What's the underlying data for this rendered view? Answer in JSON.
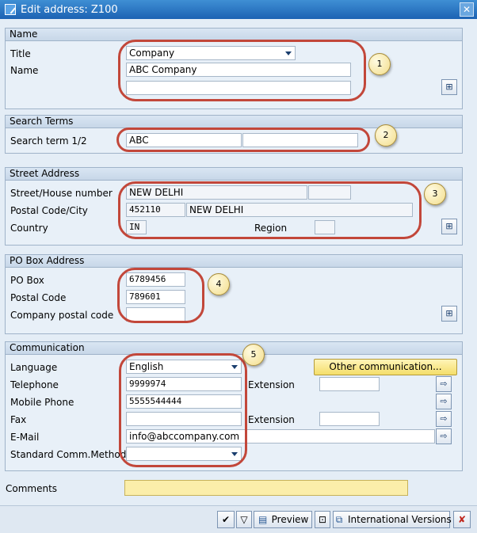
{
  "window": {
    "title": "Edit address:  Z100",
    "close_glyph": "✕"
  },
  "name_group": {
    "header": "Name",
    "title_label": "Title",
    "title_value": "Company",
    "name_label": "Name",
    "name_value": "ABC Company",
    "name2_value": ""
  },
  "search_group": {
    "header": "Search Terms",
    "label": "Search term 1/2",
    "term1": "ABC",
    "term2": ""
  },
  "street_group": {
    "header": "Street Address",
    "street_label": "Street/House number",
    "street_value": "NEW DELHI",
    "house_value": "",
    "postal_label": "Postal Code/City",
    "postal_value": "452110",
    "city_value": "NEW DELHI",
    "country_label": "Country",
    "country_value": "IN",
    "region_label": "Region",
    "region_value": ""
  },
  "pobox_group": {
    "header": "PO Box Address",
    "pobox_label": "PO Box",
    "pobox_value": "6789456",
    "postal_label": "Postal Code",
    "postal_value": "789601",
    "company_postal_label": "Company postal code",
    "company_postal_value": ""
  },
  "comm_group": {
    "header": "Communication",
    "language_label": "Language",
    "language_value": "English",
    "other_comm_label": "Other communication...",
    "telephone_label": "Telephone",
    "telephone_value": "9999974",
    "extension_label": "Extension",
    "extension_value": "",
    "mobile_label": "Mobile Phone",
    "mobile_value": "5555544444",
    "fax_label": "Fax",
    "fax_value": "",
    "fax_extension_label": "Extension",
    "fax_extension_value": "",
    "email_label": "E-Mail",
    "email_value": "info@abccompany.com",
    "std_method_label": "Standard Comm.Method",
    "std_method_value": ""
  },
  "comments": {
    "label": "Comments",
    "value": ""
  },
  "callouts": [
    "1",
    "2",
    "3",
    "4",
    "5"
  ],
  "toolbar": {
    "preview_label": "Preview",
    "intl_versions_label": "International Versions"
  },
  "icons": {
    "more-fields": "⊞",
    "arrow-right": "⇨",
    "check": "✔",
    "close": "✘"
  },
  "colors": {
    "titlebar": "#1c62b3",
    "callout_border": "#c2473a",
    "highlight_button": "#f4de6a"
  }
}
